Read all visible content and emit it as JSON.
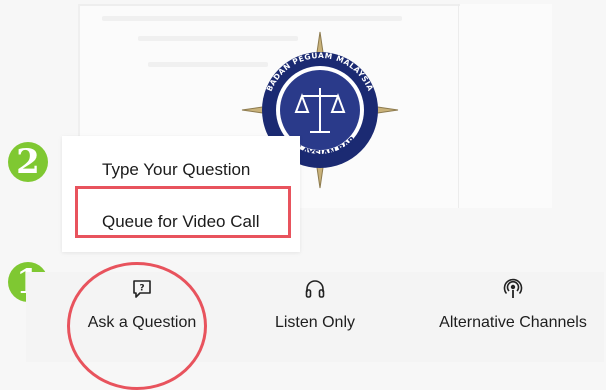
{
  "colors": {
    "badge_green": "#7fc832",
    "highlight_red": "#e8535d",
    "logo_navy": "#1b2a72",
    "logo_gold": "#c9b27a"
  },
  "steps": {
    "step_one": "1",
    "step_two": "2"
  },
  "logo": {
    "ring_text_top": "BADAN PEGUAM MALAYSIA",
    "ring_text_bottom": "MALAYSIAN BAR"
  },
  "ask_menu": {
    "items": [
      {
        "label": "Type Your Question"
      },
      {
        "label": "Queue for Video Call"
      }
    ]
  },
  "bottom_bar": {
    "items": [
      {
        "label": "Ask a Question",
        "icon": "question-bubble-icon"
      },
      {
        "label": "Listen Only",
        "icon": "headphones-icon"
      },
      {
        "label": "Alternative Channels",
        "icon": "podcast-icon"
      }
    ]
  }
}
